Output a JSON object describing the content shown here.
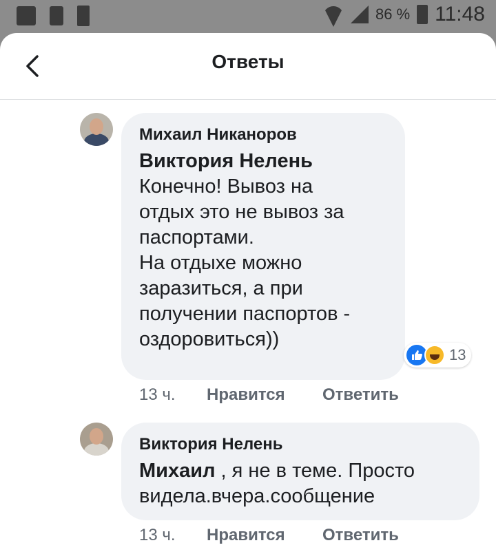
{
  "status_bar": {
    "battery_percent": "86 %",
    "time": "11:48"
  },
  "header": {
    "title": "Ответы"
  },
  "comments": [
    {
      "author": "Михаил Никаноров",
      "mention": "Виктория Нелень",
      "text": "Конечно! Вывоз на\nотдых это не вывоз за\nпаспортами.\nНа отдыхе можно\nзаразиться, а при\nполучении паспортов -\nоздоровиться))",
      "time": "13 ч.",
      "like_label": "Нравится",
      "reply_label": "Ответить",
      "reaction_count": "13",
      "reaction_icons": [
        "like-icon",
        "haha-icon"
      ]
    },
    {
      "author": "Виктория Нелень",
      "mention": "Михаил",
      "text": " , я не в теме. Просто\nвидела.вчера.сообщение",
      "time": "13 ч.",
      "like_label": "Нравится",
      "reply_label": "Ответить"
    }
  ],
  "colors": {
    "bubble": "#f0f2f5",
    "meta_text": "#606770",
    "like_blue": "#1877f2",
    "haha_yellow": "#f7b928"
  }
}
